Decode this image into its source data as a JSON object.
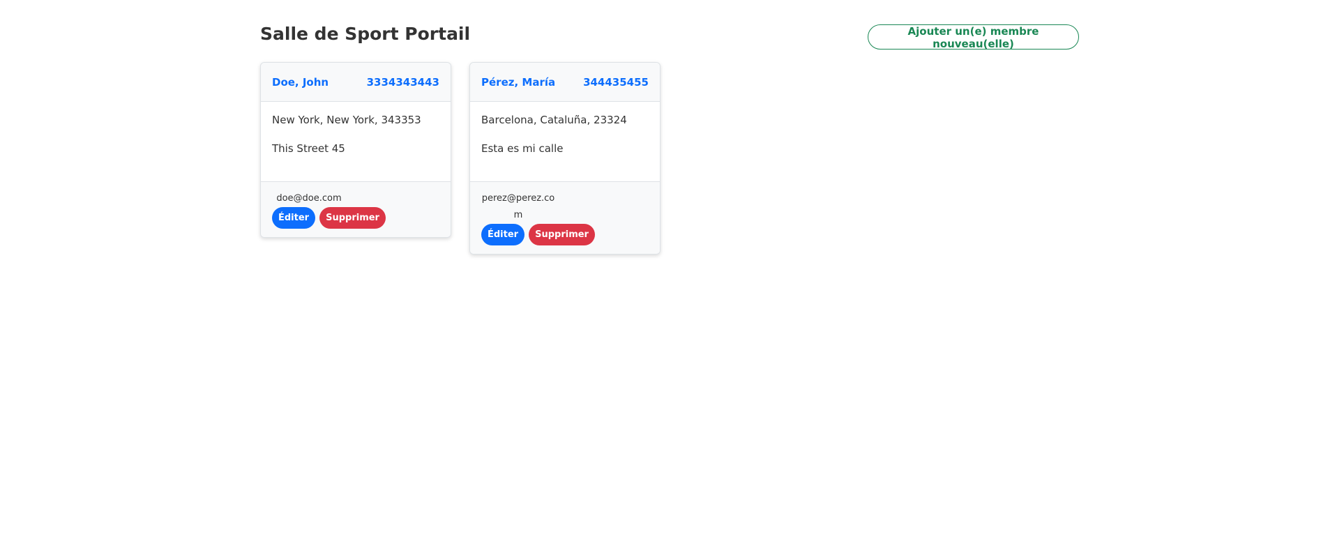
{
  "header": {
    "title": "Salle de Sport Portail",
    "add_member_label": "Ajouter un(e) membre nouveau(elle)"
  },
  "members": [
    {
      "name": "Doe, John",
      "phone": "3334343443",
      "city_line": "New York, New York, 343353",
      "street": "This Street 45",
      "email": "doe@doe.com",
      "edit_label": "Éditer",
      "delete_label": "Supprimer"
    },
    {
      "name": "Pérez, María",
      "phone": "344435455",
      "city_line": "Barcelona, Cataluña, 23324",
      "street": "Esta es mi calle",
      "email": "perez@perez.com",
      "edit_label": "Éditer",
      "delete_label": "Supprimer"
    }
  ],
  "colors": {
    "primary": "#0d6efd",
    "danger": "#dc3545",
    "success": "#198754"
  }
}
